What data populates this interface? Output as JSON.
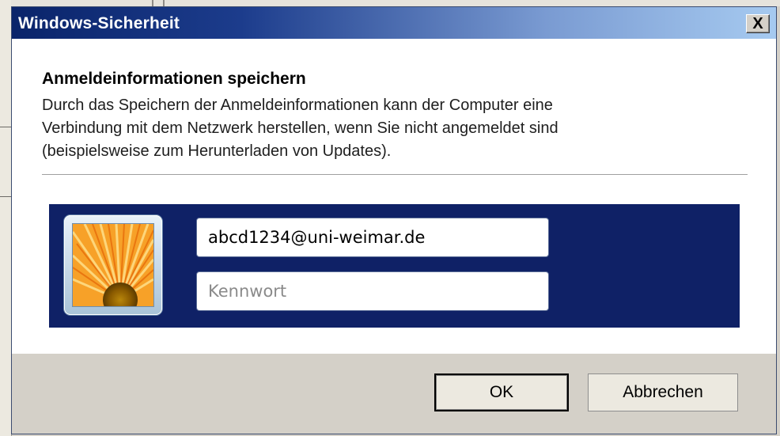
{
  "window": {
    "title": "Windows-Sicherheit",
    "close_label": "X"
  },
  "message": {
    "heading": "Anmeldeinformationen speichern",
    "lines": [
      "Durch das Speichern der Anmeldeinformationen kann der Computer eine",
      "Verbindung mit dem Netzwerk herstellen, wenn Sie nicht angemeldet sind",
      "(beispielsweise zum Herunterladen von Updates)."
    ]
  },
  "credentials": {
    "avatar_icon": "user-avatar-flower",
    "username_value": "abcd1234@uni-weimar.de",
    "password_placeholder": "Kennwort",
    "password_value": ""
  },
  "buttons": {
    "ok_label": "OK",
    "cancel_label": "Abbrechen"
  },
  "colors": {
    "panel_bg": "#0f2166",
    "title_start": "#0a246a",
    "title_end": "#a6caf0"
  }
}
